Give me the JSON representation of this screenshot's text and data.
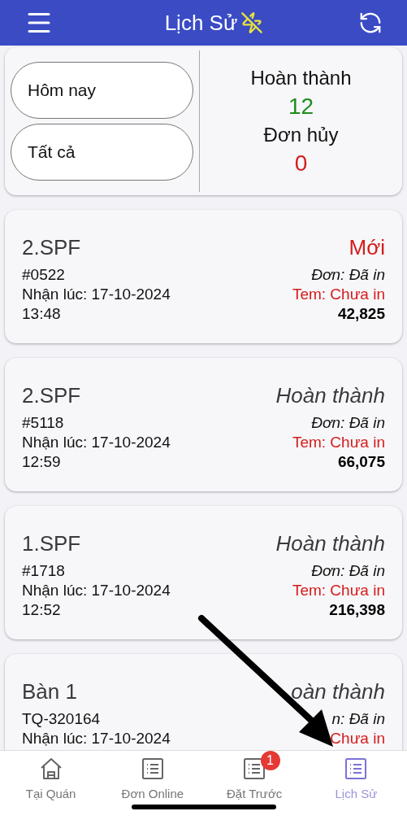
{
  "header": {
    "title": "Lịch Sử"
  },
  "summary": {
    "filters": [
      {
        "label": "Hôm nay"
      },
      {
        "label": "Tất cả"
      }
    ],
    "stats": [
      {
        "label": "Hoàn thành",
        "value": "12",
        "color": "#1e8c1e"
      },
      {
        "label": "Đơn hủy",
        "value": "0",
        "color": "#d41c1c"
      }
    ]
  },
  "orders": [
    {
      "title": "2.SPF",
      "status": "Mới",
      "kind": "new",
      "code": "#0522",
      "received": "Nhận lúc: 17-10-2024",
      "time": "13:48",
      "print_order": "Đơn: Đã in",
      "print_label": "Tem: Chưa in",
      "total": "42,825"
    },
    {
      "title": "2.SPF",
      "status": "Hoàn thành",
      "kind": "done",
      "code": "#5118",
      "received": "Nhận lúc: 17-10-2024",
      "time": "12:59",
      "print_order": "Đơn: Đã in",
      "print_label": "Tem: Chưa in",
      "total": "66,075"
    },
    {
      "title": "1.SPF",
      "status": "Hoàn thành",
      "kind": "done",
      "code": "#1718",
      "received": "Nhận lúc: 17-10-2024",
      "time": "12:52",
      "print_order": "Đơn: Đã in",
      "print_label": "Tem: Chưa in",
      "total": "216,398"
    },
    {
      "title": "Bàn 1",
      "status": "oàn thành",
      "kind": "done",
      "code": "TQ-320164",
      "received": "Nhận lúc: 17-10-2024",
      "print_order": "n: Đã in",
      "print_label": "Chưa in"
    }
  ],
  "tab_bar": [
    {
      "label": "Tại Quán",
      "selected": false
    },
    {
      "label": "Đơn Online",
      "selected": false
    },
    {
      "label": "Đặt Trước",
      "selected": false,
      "badge": "1"
    },
    {
      "label": "Lịch Sử",
      "selected": true
    }
  ]
}
